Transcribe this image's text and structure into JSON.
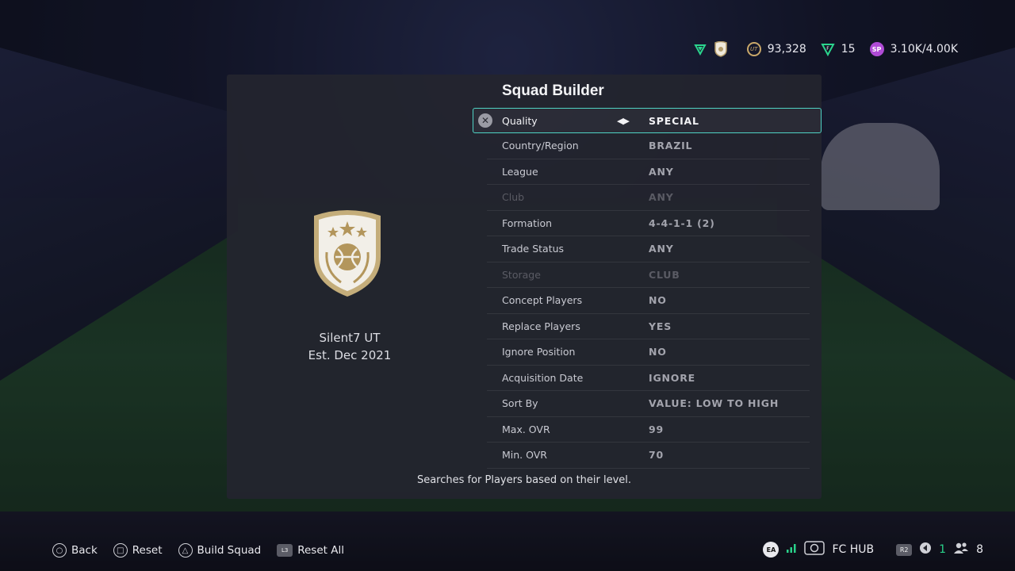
{
  "topbar": {
    "coins": "93,328",
    "points": "15",
    "sp": "3.10K/4.00K",
    "coin_icon_text": "UT",
    "sp_icon_text": "SP"
  },
  "club": {
    "name": "Silent7 UT",
    "established": "Est. Dec 2021"
  },
  "squad_builder": {
    "title": "Squad Builder",
    "rows": [
      {
        "label": "Quality",
        "value": "SPECIAL"
      },
      {
        "label": "Country/Region",
        "value": "BRAZIL"
      },
      {
        "label": "League",
        "value": "ANY"
      },
      {
        "label": "Club",
        "value": "ANY"
      },
      {
        "label": "Formation",
        "value": "4-4-1-1 (2)"
      },
      {
        "label": "Trade Status",
        "value": "ANY"
      },
      {
        "label": "Storage",
        "value": "CLUB"
      },
      {
        "label": "Concept Players",
        "value": "NO"
      },
      {
        "label": "Replace Players",
        "value": "YES"
      },
      {
        "label": "Ignore Position",
        "value": "NO"
      },
      {
        "label": "Acquisition Date",
        "value": "IGNORE"
      },
      {
        "label": "Sort By",
        "value": "VALUE: LOW TO HIGH"
      },
      {
        "label": "Max. OVR",
        "value": "99"
      },
      {
        "label": "Min. OVR",
        "value": "70"
      }
    ],
    "hint": "Searches for Players based on their level."
  },
  "footer": {
    "back": "Back",
    "reset": "Reset",
    "build_squad": "Build Squad",
    "reset_all": "Reset All",
    "l3_text": "L3",
    "hub": "FC HUB",
    "r2_text": "R2",
    "ea_text": "EA",
    "notifications": "1",
    "friends": "8"
  },
  "colors": {
    "accent": "#4fd3c4",
    "panel": "#24252e",
    "sp": "#b04bd6",
    "coin": "#c9a86a",
    "online": "#29d18a"
  }
}
